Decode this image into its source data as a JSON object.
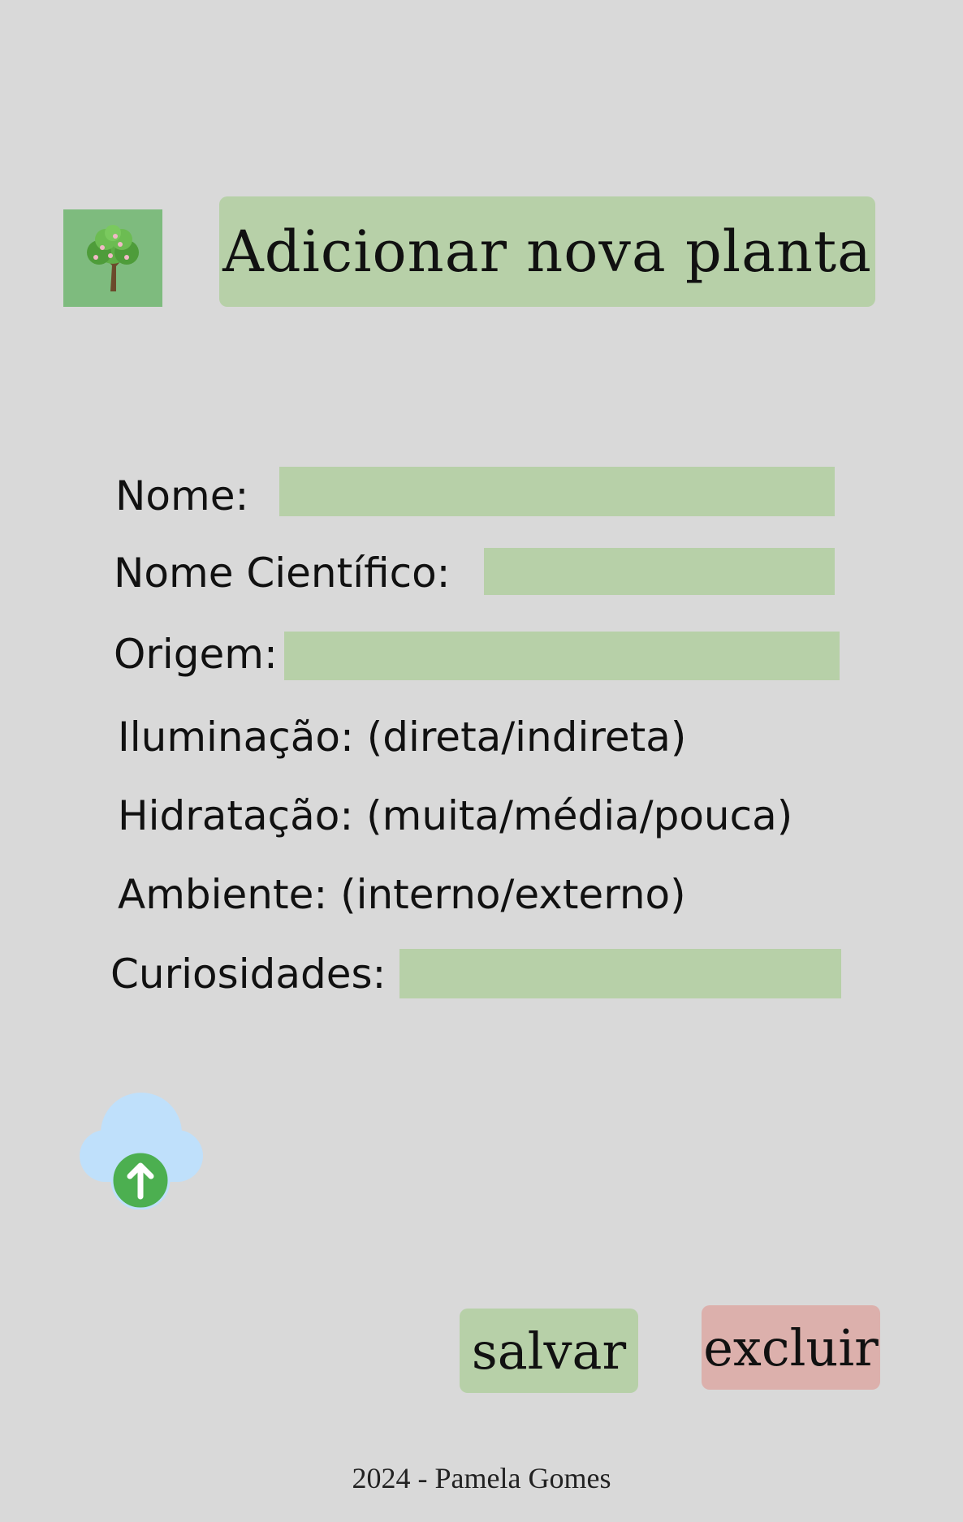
{
  "header": {
    "logo_icon": "tree-icon",
    "title": "Adicionar nova planta"
  },
  "form": {
    "nome_label": "Nome:",
    "nome_value": "",
    "nome_cientifico_label": "Nome Científico:",
    "nome_cientifico_value": "",
    "origem_label": "Origem:",
    "origem_value": "",
    "iluminacao_label": "Iluminação: (direta/indireta)",
    "hidratacao_label": "Hidratação: (muita/média/pouca)",
    "ambiente_label": "Ambiente: (interno/externo)",
    "curiosidades_label": "Curiosidades:",
    "curiosidades_value": ""
  },
  "upload": {
    "icon": "cloud-upload-icon"
  },
  "actions": {
    "save_label": "salvar",
    "delete_label": "excluir"
  },
  "footer": {
    "text": "2024 - Pamela Gomes"
  },
  "colors": {
    "background": "#d9d9d9",
    "field_green": "#b7d0a8",
    "logo_green": "#7ebb7e",
    "delete_red": "#dcb0ac",
    "cloud_blue": "#bfe0fb",
    "upload_green": "#4caf50"
  }
}
